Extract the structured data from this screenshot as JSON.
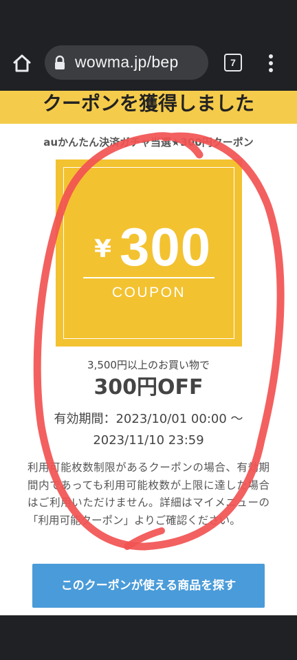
{
  "browser": {
    "url": "wowma.jp/bep",
    "tab_count": "7"
  },
  "page": {
    "banner": "クーポンを獲得しました",
    "coupon_name": "auかんたん決済ガチャ当選★300円クーポン",
    "coupon": {
      "currency": "¥",
      "amount": "300",
      "label": "COUPON"
    },
    "condition": "3,500円以上のお買い物で",
    "discount": "300円OFF",
    "period_line1": "有効期間：2023/10/01 00:00 〜",
    "period_line2": "2023/11/10 23:59",
    "note": "利用可能枚数制限があるクーポンの場合、有効期間内であっても利用可能枚数が上限に達した場合はご利用いただけません。詳細はマイメニューの「利用可能クーポン」よりご確認ください。",
    "search_button": "このクーポンが使える商品を探す"
  },
  "colors": {
    "banner": "#f5cb4b",
    "ticket": "#f3c230",
    "button": "#4a9bd9",
    "annotation": "#f25252"
  },
  "annotation": "red hand-drawn circle around coupon"
}
